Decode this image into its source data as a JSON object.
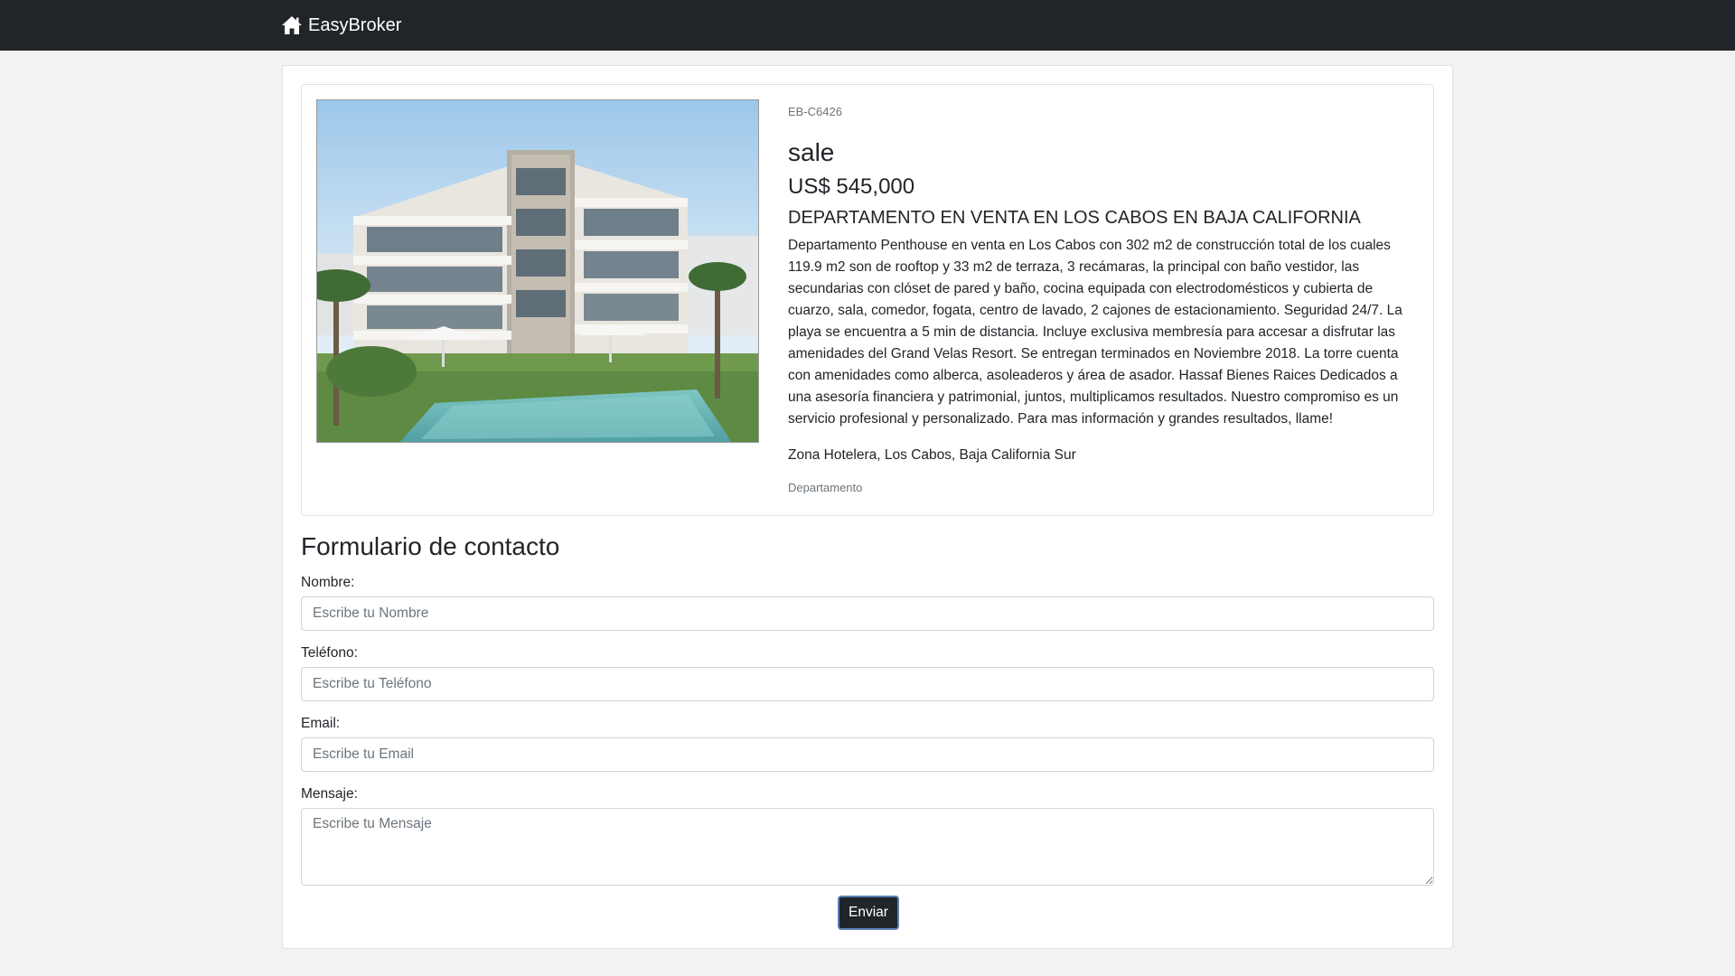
{
  "navbar": {
    "brand_icon": "home-icon",
    "brand_label": "EasyBroker"
  },
  "listing": {
    "public_id": "EB-C6426",
    "operation": "sale",
    "price": "US$ 545,000",
    "title": "DEPARTAMENTO EN VENTA EN LOS CABOS EN BAJA CALIFORNIA",
    "description": "Departamento Penthouse en venta en Los Cabos con 302 m2 de construcción total de los cuales 119.9 m2 son de rooftop y 33 m2 de terraza, 3 recámaras, la principal con baño vestidor, las secundarias con clóset de pared y baño, cocina equipada con electrodomésticos y cubierta de cuarzo, sala, comedor, fogata, centro de lavado, 2 cajones de estacionamiento. Seguridad 24/7. La playa se encuentra a 5 min de distancia. Incluye exclusiva membresía para accesar a disfrutar las amenidades del Grand Velas Resort. Se entregan terminados en Noviembre 2018. La torre cuenta con amenidades como alberca, asoleaderos y área de asador. Hassaf Bienes Raices Dedicados a una asesoría financiera y patrimonial, juntos, multiplicamos resultados. Nuestro compromiso es un servicio profesional y personalizado. Para mas información y grandes resultados, llame!",
    "location": "Zona Hotelera, Los Cabos, Baja California Sur",
    "property_type": "Departamento"
  },
  "contact_form": {
    "title": "Formulario de contacto",
    "name_label": "Nombre:",
    "name_placeholder": "Escribe tu Nombre",
    "phone_label": "Teléfono:",
    "phone_placeholder": "Escribe tu Teléfono",
    "email_label": "Email:",
    "email_placeholder": "Escribe tu Email",
    "message_label": "Mensaje:",
    "message_placeholder": "Escribe tu Mensaje",
    "submit_label": "Enviar"
  },
  "colors": {
    "navbar_bg": "#212529",
    "page_bg": "#f2f2f2",
    "button_bg": "#212529"
  }
}
